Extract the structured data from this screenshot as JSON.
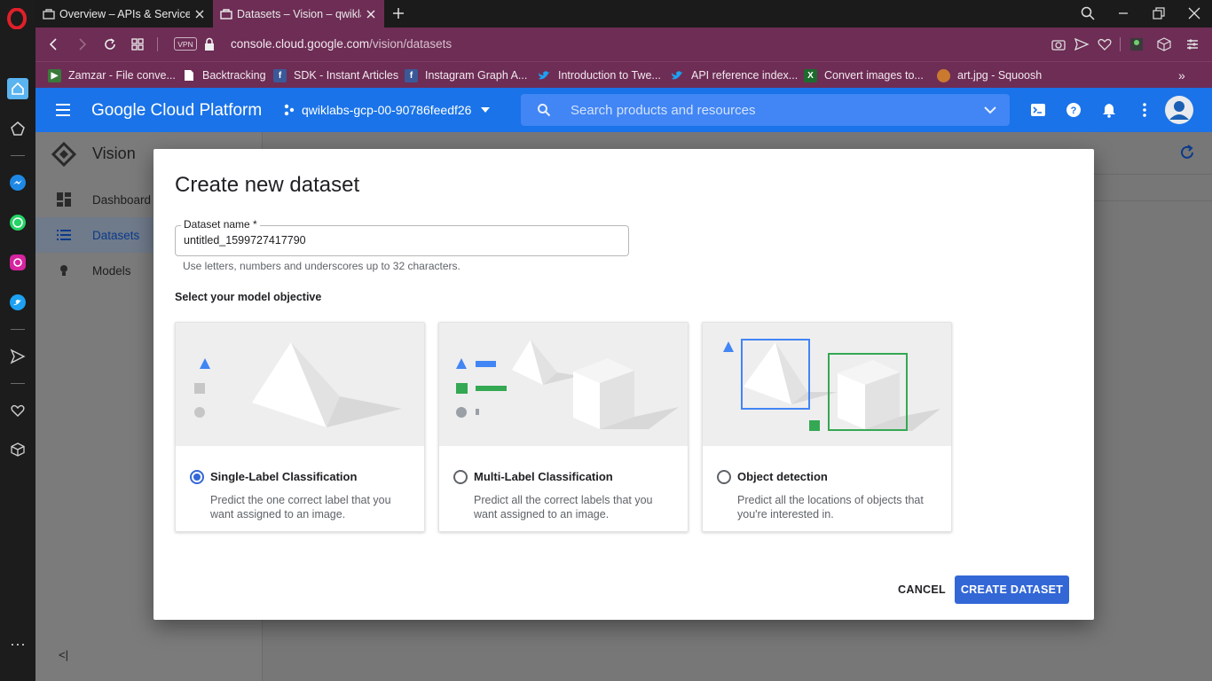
{
  "browser": {
    "tabs": [
      {
        "title": "Overview – APIs & Services",
        "active": false
      },
      {
        "title": "Datasets – Vision – qwiklabs",
        "active": true
      }
    ],
    "vpn_label": "VPN",
    "url_host": "console.cloud.google.com",
    "url_path": "/vision/datasets",
    "bookmarks": [
      {
        "label": "Zamzar - File conve...",
        "icon": "zamzar-icon"
      },
      {
        "label": "Backtracking",
        "icon": "page-icon"
      },
      {
        "label": "SDK - Instant Articles",
        "icon": "facebook-icon"
      },
      {
        "label": "Instagram Graph A...",
        "icon": "facebook-icon"
      },
      {
        "label": "Introduction to Twe...",
        "icon": "twitter-icon"
      },
      {
        "label": "API reference index...",
        "icon": "twitter-icon"
      },
      {
        "label": "Convert images to...",
        "icon": "excel-icon"
      },
      {
        "label": "art.jpg - Squoosh",
        "icon": "squoosh-icon"
      }
    ]
  },
  "gcp": {
    "brand": "Google Cloud Platform",
    "project": "qwiklabs-gcp-00-90786feedf26",
    "search_placeholder": "Search products and resources",
    "accent": "#1a73e8"
  },
  "leftnav": {
    "title": "Vision",
    "items": [
      {
        "label": "Dashboard",
        "icon": "dashboard-icon",
        "active": false
      },
      {
        "label": "Datasets",
        "icon": "list-icon",
        "active": true
      },
      {
        "label": "Models",
        "icon": "lightbulb-icon",
        "active": false
      }
    ],
    "collapse_label": "<|"
  },
  "dialog": {
    "title": "Create new dataset",
    "dataset_name_label": "Dataset name *",
    "dataset_name_value": "untitled_1599727417790",
    "helper_text": "Use letters, numbers and underscores up to 32 characters.",
    "objective_label": "Select your model objective",
    "options": [
      {
        "title": "Single-Label Classification",
        "description": "Predict the one correct label that you want assigned to an image.",
        "selected": true
      },
      {
        "title": "Multi-Label Classification",
        "description": "Predict all the correct labels that you want assigned to an image.",
        "selected": false
      },
      {
        "title": "Object detection",
        "description": "Predict all the locations of objects that you're interested in.",
        "selected": false
      }
    ],
    "cancel_label": "CANCEL",
    "create_label": "CREATE DATASET",
    "primary_color": "#3367d6"
  }
}
